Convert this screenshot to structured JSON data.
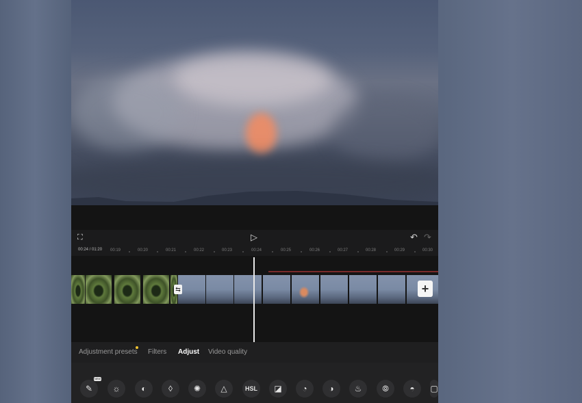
{
  "controls": {
    "fullscreen_icon": "⛶",
    "play_icon": "▷",
    "undo_icon": "↶",
    "redo_icon": "↷"
  },
  "ruler": {
    "timecode": "00:24 / 01:20",
    "ticks": [
      "00:19",
      "00:20",
      "00:21",
      "00:22",
      "00:23",
      "00:24",
      "00:25",
      "00:26",
      "00:27",
      "00:28",
      "00:29",
      "00:30"
    ]
  },
  "timeline": {
    "transition_icon": "⇆",
    "add_icon": "+"
  },
  "tabs": [
    {
      "label": "Adjustment presets"
    },
    {
      "label": "Filters"
    },
    {
      "label": "Adjust"
    },
    {
      "label": "Video quality"
    }
  ],
  "tools": [
    {
      "icon": "magic-wand-icon",
      "glyph": "✎"
    },
    {
      "icon": "brightness-icon",
      "glyph": "☼"
    },
    {
      "icon": "contrast-icon",
      "glyph": "◐"
    },
    {
      "icon": "saturation-drop-icon",
      "glyph": "◊"
    },
    {
      "icon": "exposure-icon",
      "glyph": "✺"
    },
    {
      "icon": "sharpen-triangle-icon",
      "glyph": "△"
    },
    {
      "icon": "hsl-icon",
      "label": "HSL"
    },
    {
      "icon": "curves-icon",
      "glyph": "◪"
    },
    {
      "icon": "highlights-icon",
      "glyph": "◔"
    },
    {
      "icon": "shadows-icon",
      "glyph": "◑"
    },
    {
      "icon": "temperature-icon",
      "glyph": "♨"
    },
    {
      "icon": "hue-icon",
      "glyph": "⦾"
    },
    {
      "icon": "fade-icon",
      "glyph": "◓"
    },
    {
      "icon": "vignette-icon",
      "glyph": "▢"
    }
  ],
  "new_badge": "NEW"
}
